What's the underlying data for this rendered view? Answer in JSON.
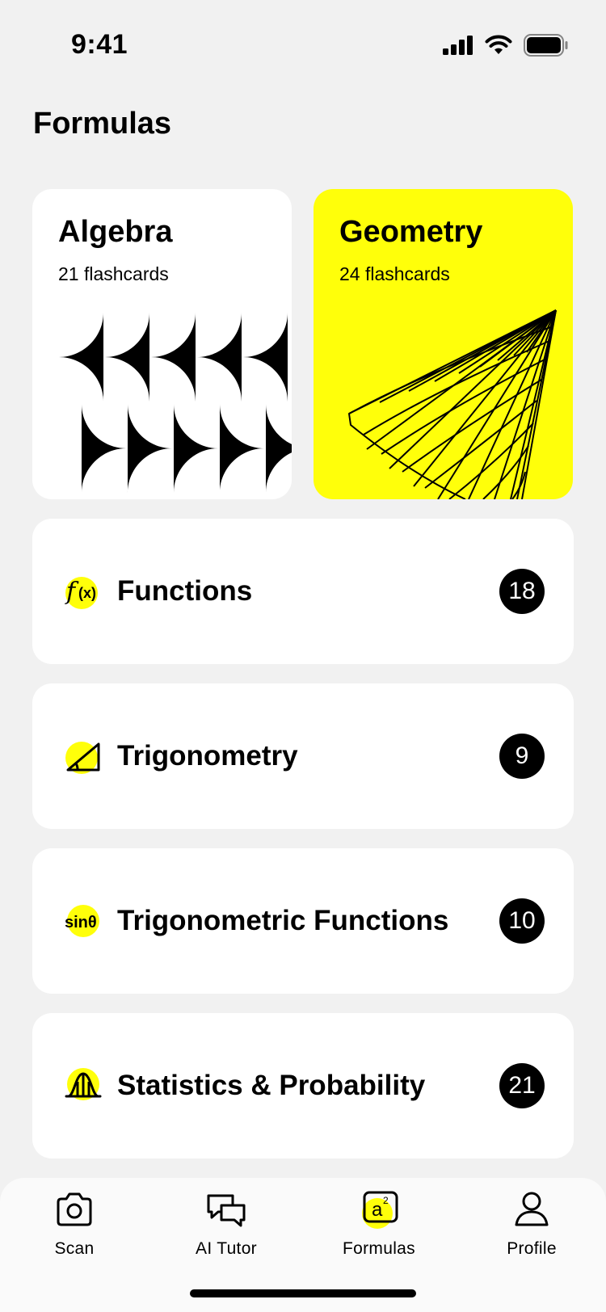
{
  "status": {
    "time": "9:41"
  },
  "page": {
    "title": "Formulas"
  },
  "hero": [
    {
      "title": "Algebra",
      "subtitle": "21 flashcards"
    },
    {
      "title": "Geometry",
      "subtitle": "24 flashcards"
    }
  ],
  "topics": [
    {
      "label": "Functions",
      "count": "18",
      "icon": "function-icon"
    },
    {
      "label": "Trigonometry",
      "count": "9",
      "icon": "right-triangle-icon"
    },
    {
      "label": "Trigonometric Functions",
      "count": "10",
      "icon": "sine-icon"
    },
    {
      "label": "Statistics & Probability",
      "count": "21",
      "icon": "bell-curve-icon"
    }
  ],
  "tabs": [
    {
      "label": "Scan",
      "icon": "camera-icon"
    },
    {
      "label": "AI Tutor",
      "icon": "chat-bubbles-icon"
    },
    {
      "label": "Formulas",
      "icon": "formula-icon",
      "active": true
    },
    {
      "label": "Profile",
      "icon": "profile-icon"
    }
  ],
  "colors": {
    "accent": "#FFFF0A",
    "background": "#F1F1F1",
    "card": "#FFFFFF",
    "badge": "#000000"
  }
}
